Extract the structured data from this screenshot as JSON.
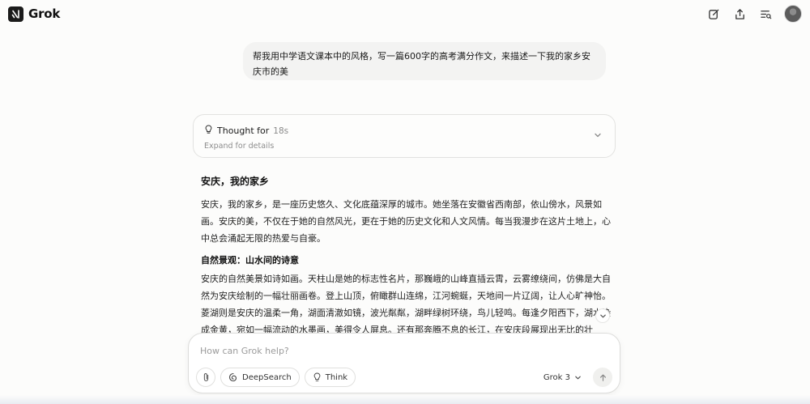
{
  "app": {
    "name": "Grok"
  },
  "icons": {
    "brand": "grok-logo-icon",
    "new_chat": "edit-icon",
    "share": "share-icon",
    "history": "history-icon",
    "avatar": "user-avatar",
    "thought": "lightbulb-icon",
    "attach": "paperclip-icon",
    "deepsearch": "deepsearch-icon",
    "think": "lightbulb-icon",
    "send": "arrow-up-icon"
  },
  "conversation": {
    "user_message": "帮我用中学语文课本中的风格，写一篇600字的高考满分作文，来描述一下我的家乡安庆市的美",
    "thought": {
      "label": "Thought for",
      "duration": "18s",
      "expand_hint": "Expand for details"
    },
    "response": {
      "title": "安庆，我的家乡",
      "paragraph_1": "安庆，我的家乡，是一座历史悠久、文化底蕴深厚的城市。她坐落在安徽省西南部，依山傍水，风景如画。安庆的美，不仅在于她的自然风光，更在于她的历史文化和人文风情。每当我漫步在这片土地上，心中总会涌起无限的热爱与自豪。",
      "section_title": "自然景观：山水间的诗意",
      "paragraph_2": "安庆的自然美景如诗如画。天柱山是她的标志性名片，那巍峨的山峰直插云霄，云雾缭绕间，仿佛是大自然为安庆绘制的一幅壮丽画卷。登上山顶，俯瞰群山连绵，江河蜿蜒，天地间一片辽阔，让人心旷神怡。菱湖则是安庆的温柔一角，湖面清澈如镜，波光粼粼，湖畔绿树环绕，鸟儿轻鸣。每逢夕阳西下，湖水染成金黄，宛如一幅流动的水墨画，美得令人屏息。还有那奔腾不息的长江，在安庆段展现出无比的壮"
    }
  },
  "composer": {
    "placeholder": "How can Grok help?",
    "value": "",
    "deepsearch_label": "DeepSearch",
    "think_label": "Think",
    "model": "Grok 3"
  }
}
